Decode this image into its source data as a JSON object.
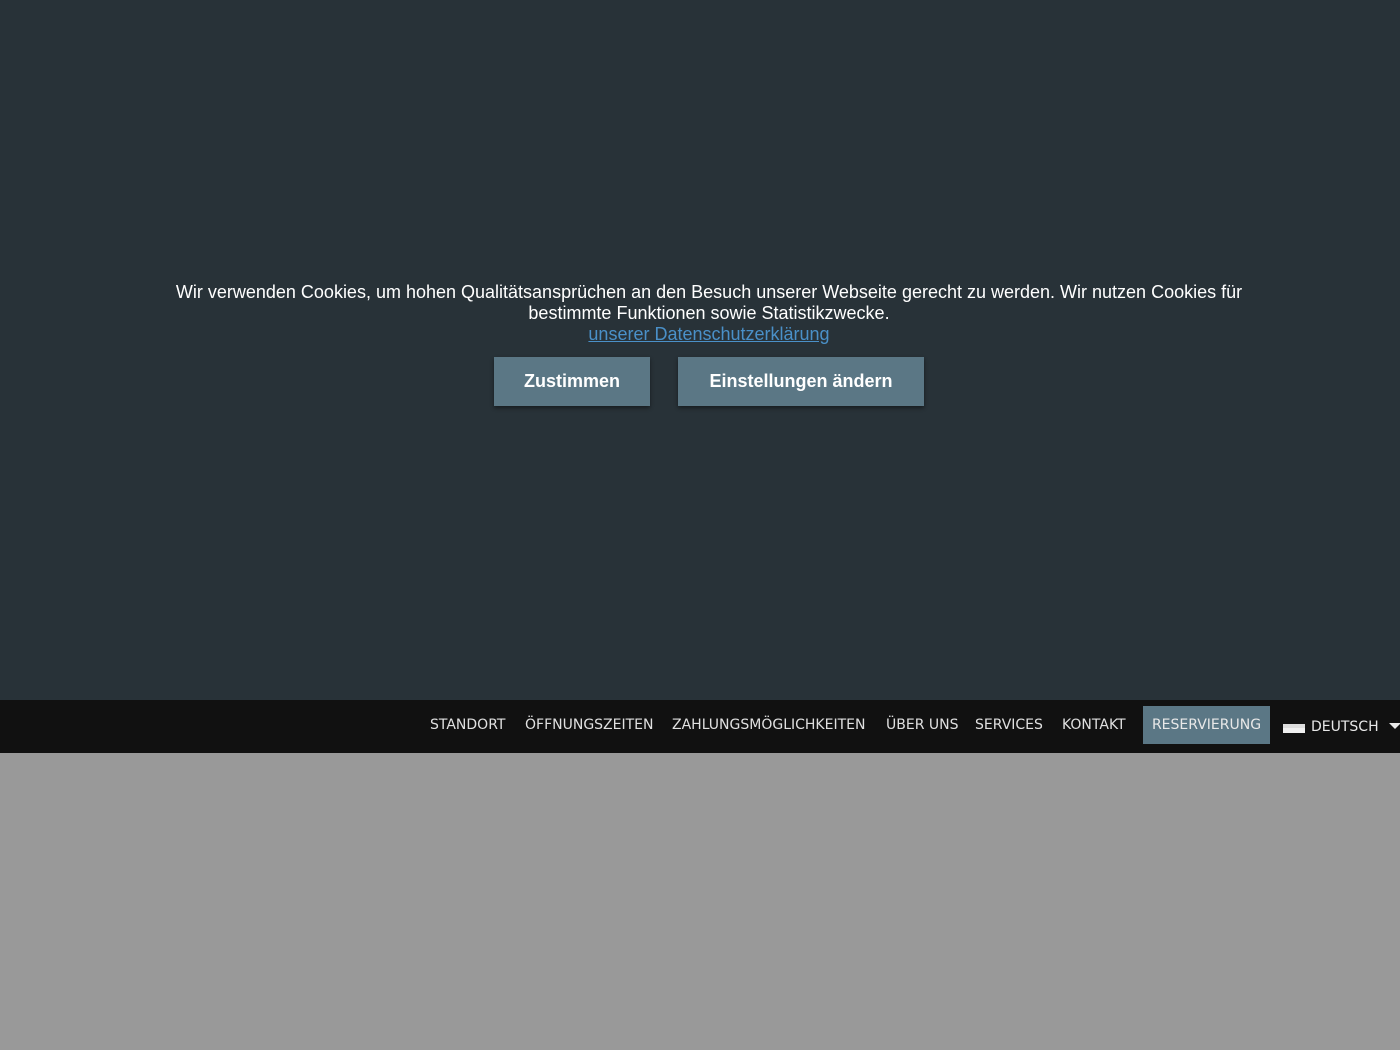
{
  "cookie_banner": {
    "text_line_1": "Wir verwenden Cookies, um hohen Qualitätsansprüchen an den Besuch unserer Webseite gerecht zu werden. Wir nutzen Cookies für",
    "text_line_2": "bestimmte Funktionen sowie Statistikzwecke.",
    "privacy_link": "unserer Datenschutzerklärung",
    "agree_label": "Zustimmen",
    "settings_label": "Einstellungen ändern"
  },
  "nav": {
    "items": [
      {
        "label": "STANDORT"
      },
      {
        "label": "ÖFFNUNGSZEITEN"
      },
      {
        "label": "ZAHLUNGSMÖGLICHKEITEN"
      },
      {
        "label": "ÜBER UNS"
      },
      {
        "label": "SERVICES"
      },
      {
        "label": "KONTAKT"
      }
    ],
    "reservation_label": "RESERVIERUNG",
    "language_label": "DEUTSCH",
    "language_icon": "german-flag-icon",
    "dropdown_icon": "caret-down-icon"
  },
  "colors": {
    "overlay_bg": "#283238",
    "button_bg": "#5b7785",
    "nav_bg": "#111111",
    "content_bg": "#999999",
    "link": "#4a90c8"
  }
}
